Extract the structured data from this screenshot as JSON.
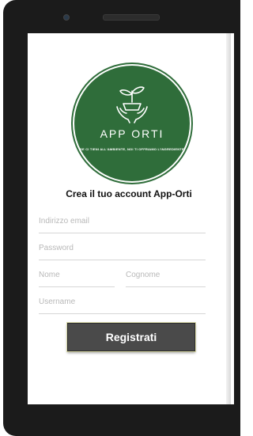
{
  "logo": {
    "title": "APP ORTI",
    "tagline": "SE CI TIENI ALL'AMBIENTE, NOI TI OFFRIAMO L'INGREDIENTE"
  },
  "form": {
    "heading": "Crea il  tuo account App-Orti",
    "email_placeholder": "Indirizzo email",
    "password_placeholder": "Password",
    "name_placeholder": "Nome",
    "surname_placeholder": "Cognome",
    "username_placeholder": "Username",
    "submit_label": "Registrati"
  },
  "colors": {
    "brand_green": "#2f6d3a",
    "button_bg": "#4a4a4a"
  }
}
